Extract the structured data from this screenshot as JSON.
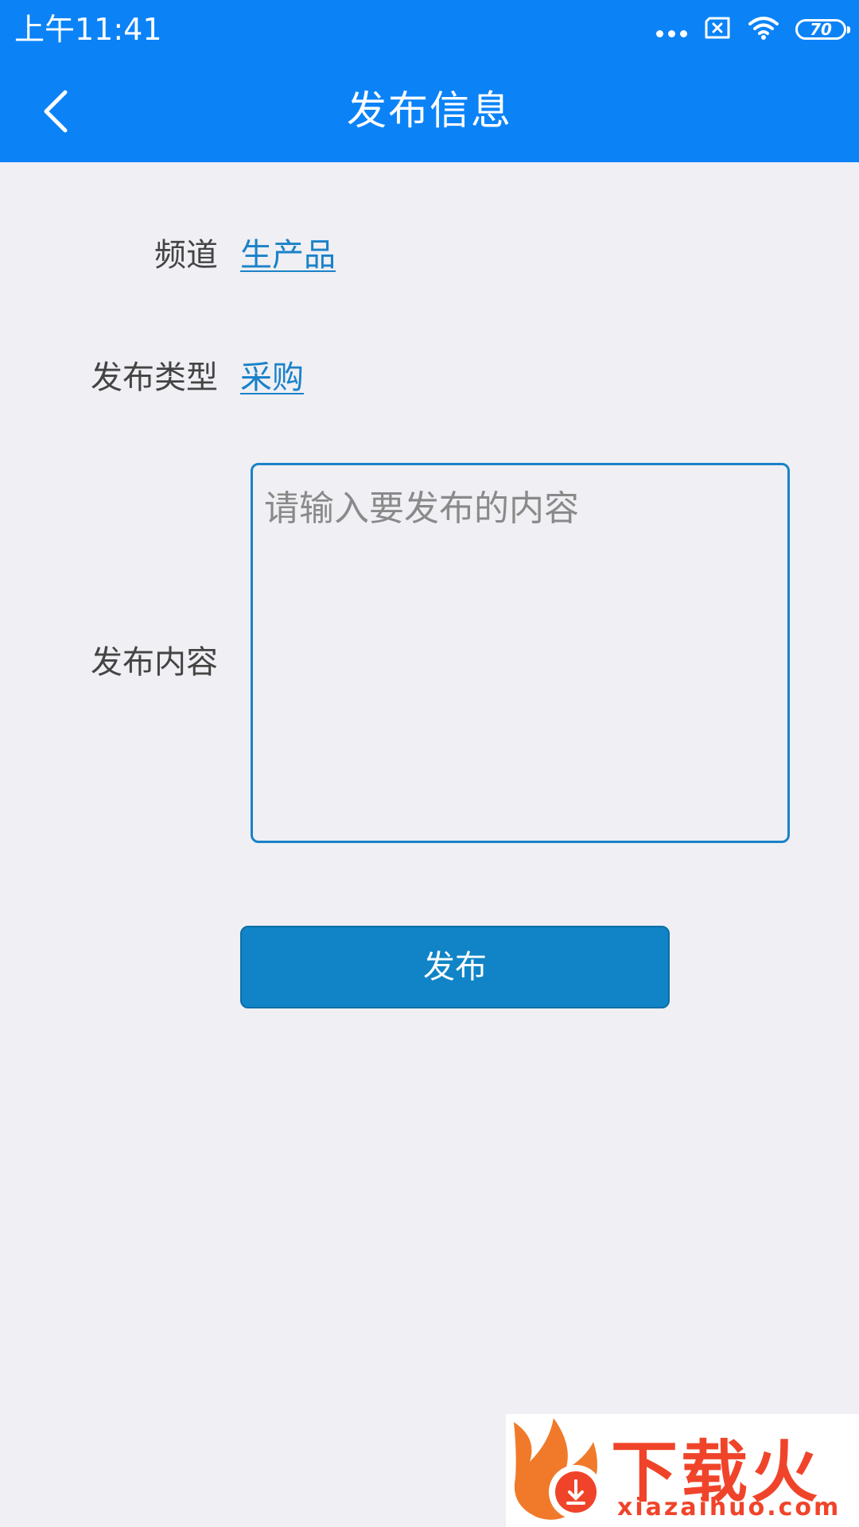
{
  "status_bar": {
    "time": "上午11:41",
    "battery": "70",
    "icons": [
      "more-dots-icon",
      "sim-x-icon",
      "wifi-icon",
      "battery-icon"
    ]
  },
  "header": {
    "title": "发布信息",
    "back_icon": "chevron-left-icon"
  },
  "form": {
    "channel_label": "频道",
    "channel_value": "生产品",
    "type_label": "发布类型",
    "type_value": "采购",
    "content_label": "发布内容",
    "content_placeholder": "请输入要发布的内容",
    "content_value": "",
    "submit_label": "发布"
  },
  "watermark": {
    "brand": "下载火",
    "domain": "xiazaihuo.com"
  },
  "colors": {
    "header_bg": "#0b83f7",
    "page_bg": "#efeff4",
    "link": "#1a82c8",
    "button_bg": "#1084c7",
    "label_text": "#444444",
    "watermark": "#f0442a"
  }
}
